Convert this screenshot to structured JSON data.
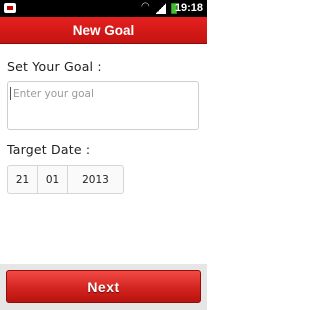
{
  "status_bar": {
    "time": "19:18",
    "icons": [
      "notification-icon",
      "wifi-icon",
      "signal-icon",
      "battery-icon"
    ]
  },
  "title_bar": {
    "title": "New Goal"
  },
  "form": {
    "goal_label": "Set Your Goal :",
    "goal_placeholder": "Enter your goal",
    "goal_value": "",
    "date_label": "Target Date :",
    "date": {
      "day": "21",
      "month": "01",
      "year": "2013"
    }
  },
  "actions": {
    "next_label": "Next"
  },
  "colors": {
    "accent": "#d42420",
    "title_bar": "#d61a18",
    "status_bar": "#000000"
  }
}
